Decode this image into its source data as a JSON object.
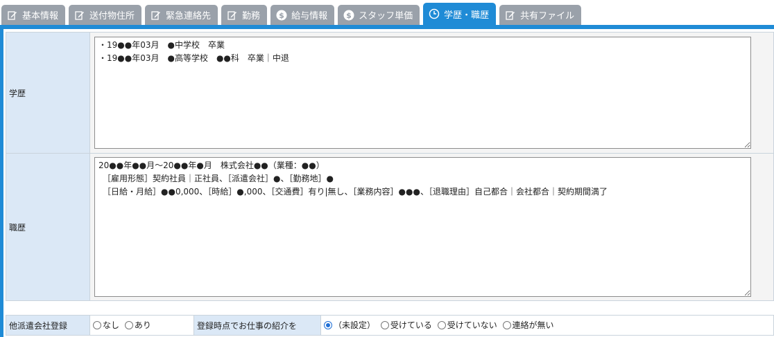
{
  "tabs": [
    {
      "label": "基本情報",
      "icon": "edit-icon"
    },
    {
      "label": "送付物住所",
      "icon": "edit-icon"
    },
    {
      "label": "緊急連絡先",
      "icon": "edit-icon"
    },
    {
      "label": "勤務",
      "icon": "edit-icon"
    },
    {
      "label": "給与情報",
      "icon": "dollar-icon"
    },
    {
      "label": "スタッフ単価",
      "icon": "dollar-icon"
    },
    {
      "label": "学歴・職歴",
      "icon": "clock-icon"
    },
    {
      "label": "共有ファイル",
      "icon": "edit-icon"
    }
  ],
  "colors": {
    "active_tab": "#1f8bd6",
    "inactive_tab": "#9aa1aa",
    "label_bg": "#dbe8f6"
  },
  "education": {
    "label": "学歴",
    "value": "・19●●年03月　●中学校　卒業\n・19●●年03月　●高等学校　●●科　卒業｜中退"
  },
  "career": {
    "label": "職歴",
    "value": "20●●年●●月～20●●年●月　株式会社●●（業種：●●）\n　［雇用形態］契約社員｜正社員、［派遣会社］●、［勤務地］●\n　［日給・月給］●●0,000、［時給］●,000、［交通費］有り|無し、［業務内容］●●●、［退職理由］自己都合｜会社都合｜契約期間満了"
  },
  "other_agency": {
    "label": "他派遣会社登録",
    "options": [
      {
        "label": "なし",
        "selected": false
      },
      {
        "label": "あり",
        "selected": false
      }
    ]
  },
  "job_intro": {
    "label": "登録時点でお仕事の紹介を",
    "options": [
      {
        "label": "（未設定）",
        "selected": true
      },
      {
        "label": "受けている",
        "selected": false
      },
      {
        "label": "受けていない",
        "selected": false
      },
      {
        "label": "連絡が無い",
        "selected": false
      }
    ]
  }
}
